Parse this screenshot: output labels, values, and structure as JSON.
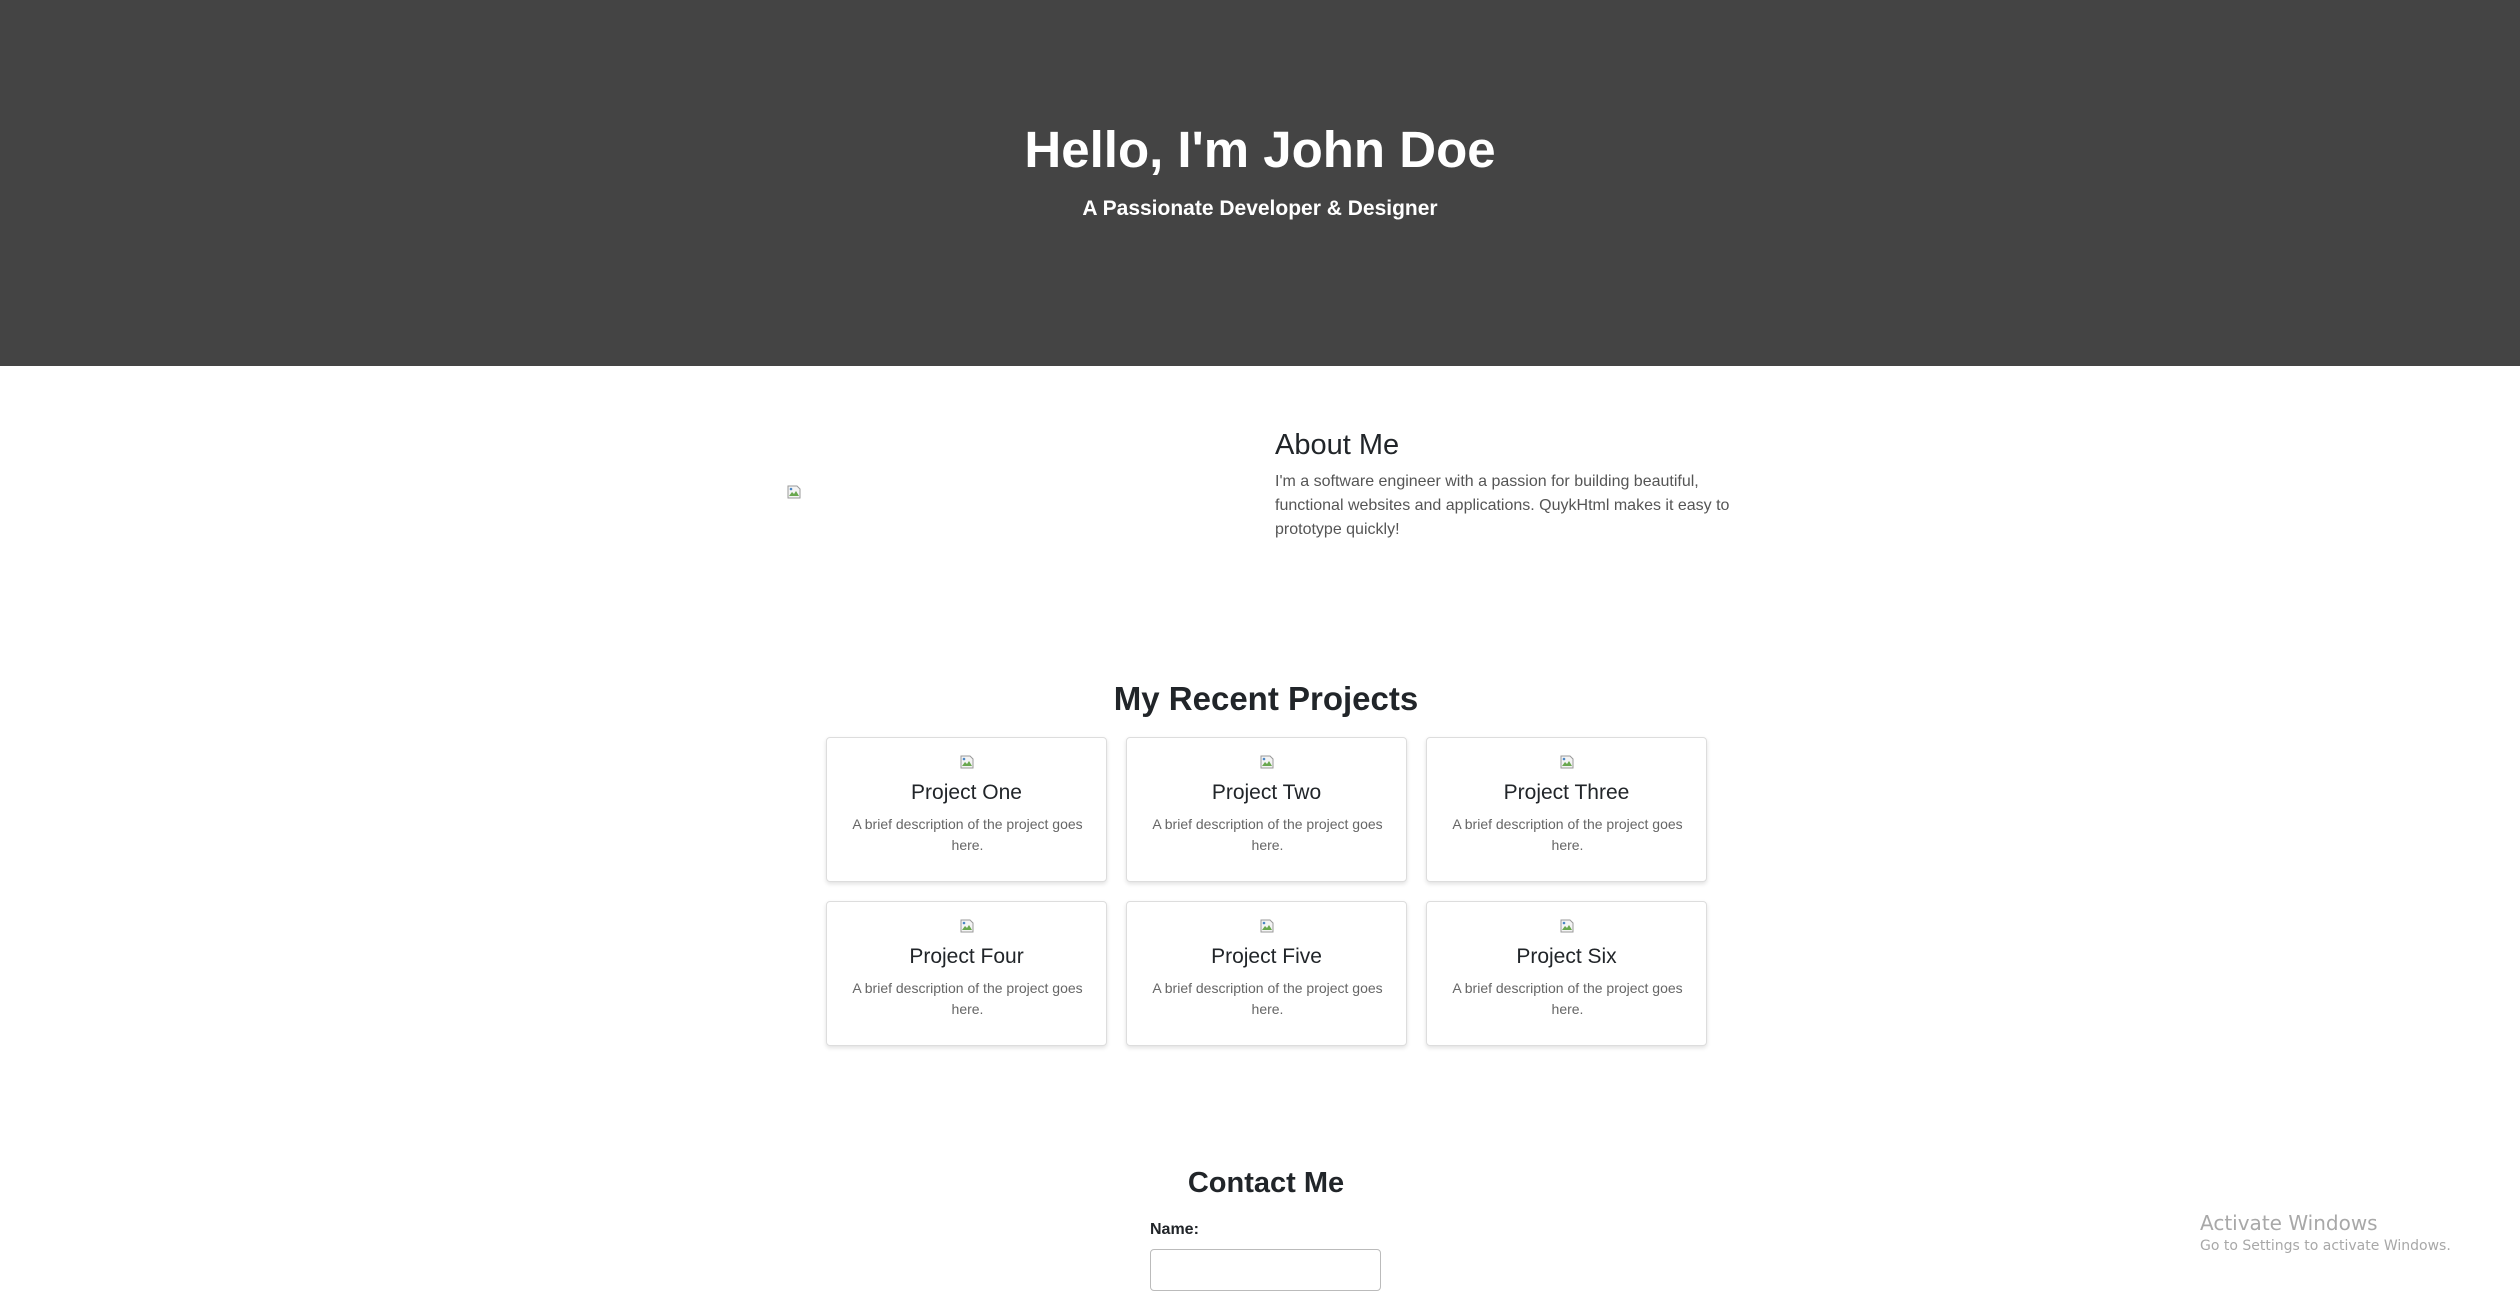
{
  "hero": {
    "title": "Hello, I'm John Doe",
    "subtitle": "A Passionate Developer & Designer",
    "background": "#444444"
  },
  "about": {
    "image_icon": "broken-image-icon",
    "title": "About Me",
    "text": "I'm a software engineer with a passion for building beautiful, functional websites and applications. QuykHtml makes it easy to prototype quickly!"
  },
  "projects": {
    "title": "My Recent Projects",
    "items": [
      {
        "name": "Project One",
        "description": "A brief description of the project goes here."
      },
      {
        "name": "Project Two",
        "description": "A brief description of the project goes here."
      },
      {
        "name": "Project Three",
        "description": "A brief description of the project goes here."
      },
      {
        "name": "Project Four",
        "description": "A brief description of the project goes here."
      },
      {
        "name": "Project Five",
        "description": "A brief description of the project goes here."
      },
      {
        "name": "Project Six",
        "description": "A brief description of the project goes here."
      }
    ]
  },
  "contact": {
    "title": "Contact Me",
    "name_label": "Name:",
    "name_value": ""
  },
  "watermark": {
    "title": "Activate Windows",
    "subtitle": "Go to Settings to activate Windows."
  }
}
